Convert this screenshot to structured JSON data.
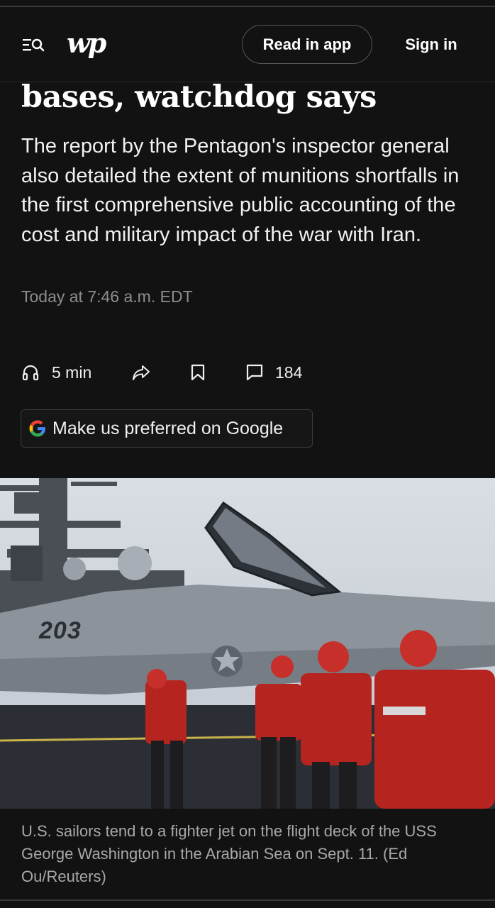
{
  "header": {
    "logo_text": "wp",
    "read_in_app_label": "Read in app",
    "sign_in_label": "Sign in"
  },
  "article": {
    "headline_fragment": "bases, watchdog says",
    "subheadline": "The report by the Pentagon's inspector general also detailed the extent of munitions shortfalls in the first comprehensive public accounting of the cost and military impact of the war with Iran.",
    "timestamp": "Today at 7:46 a.m. EDT"
  },
  "actions": {
    "listen_label": "5 min",
    "comments_count": "184"
  },
  "google_button": {
    "label": "Make us preferred on Google"
  },
  "photo": {
    "jet_number": "203",
    "caption": "U.S. sailors tend to a fighter jet on the flight deck of the USS George Washington in the Arabian Sea on Sept. 11. (Ed Ou/Reuters)"
  },
  "colors": {
    "background": "#121212",
    "text": "#ffffff",
    "muted_text": "#8d8d8d",
    "sailor_red": "#b5241f"
  }
}
